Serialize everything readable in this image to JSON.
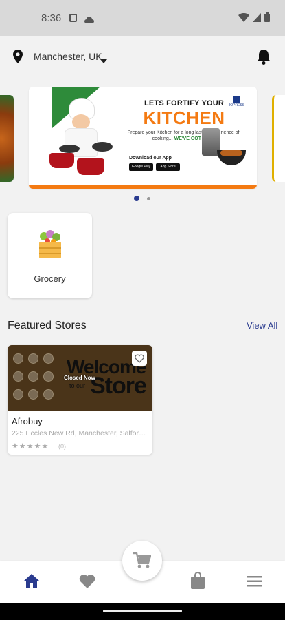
{
  "status_bar": {
    "time": "8:36"
  },
  "header": {
    "location": "Manchester, UK"
  },
  "banner": {
    "title_line1": "LETS FORTIFY YOUR",
    "title_line2": "KITCHEN",
    "subtitle": "Prepare your Kitchen for a long lasting experience of cooking...",
    "subtitle_emph": "WE'VE GOT YOU!",
    "download": "Download our App",
    "badge_google": "Google Play",
    "badge_apple": "App Store",
    "brand": "IOPRESS",
    "accent_color": "#f47a12",
    "active_slide": 1,
    "slide_count": 2
  },
  "categories": [
    {
      "label": "Grocery",
      "icon": "grocery-crate-icon"
    }
  ],
  "featured": {
    "title": "Featured Stores",
    "view_all": "View All",
    "stores": [
      {
        "name": "Afrobuy",
        "address": "225 Eccles New Rd, Manchester, Salford ...",
        "status": "Closed Now",
        "image_text_1": "Welcome",
        "image_text_2": "to our",
        "image_text_3": "Store",
        "rating_stars": "★★★★★",
        "rating_count": "(0)",
        "rating": 0
      }
    ]
  },
  "nav": {
    "items": [
      "home-icon",
      "heart-icon",
      "cart-icon",
      "bag-icon",
      "menu-icon"
    ],
    "active": "home",
    "active_color": "#2a3b8f",
    "inactive_color": "#888888"
  }
}
